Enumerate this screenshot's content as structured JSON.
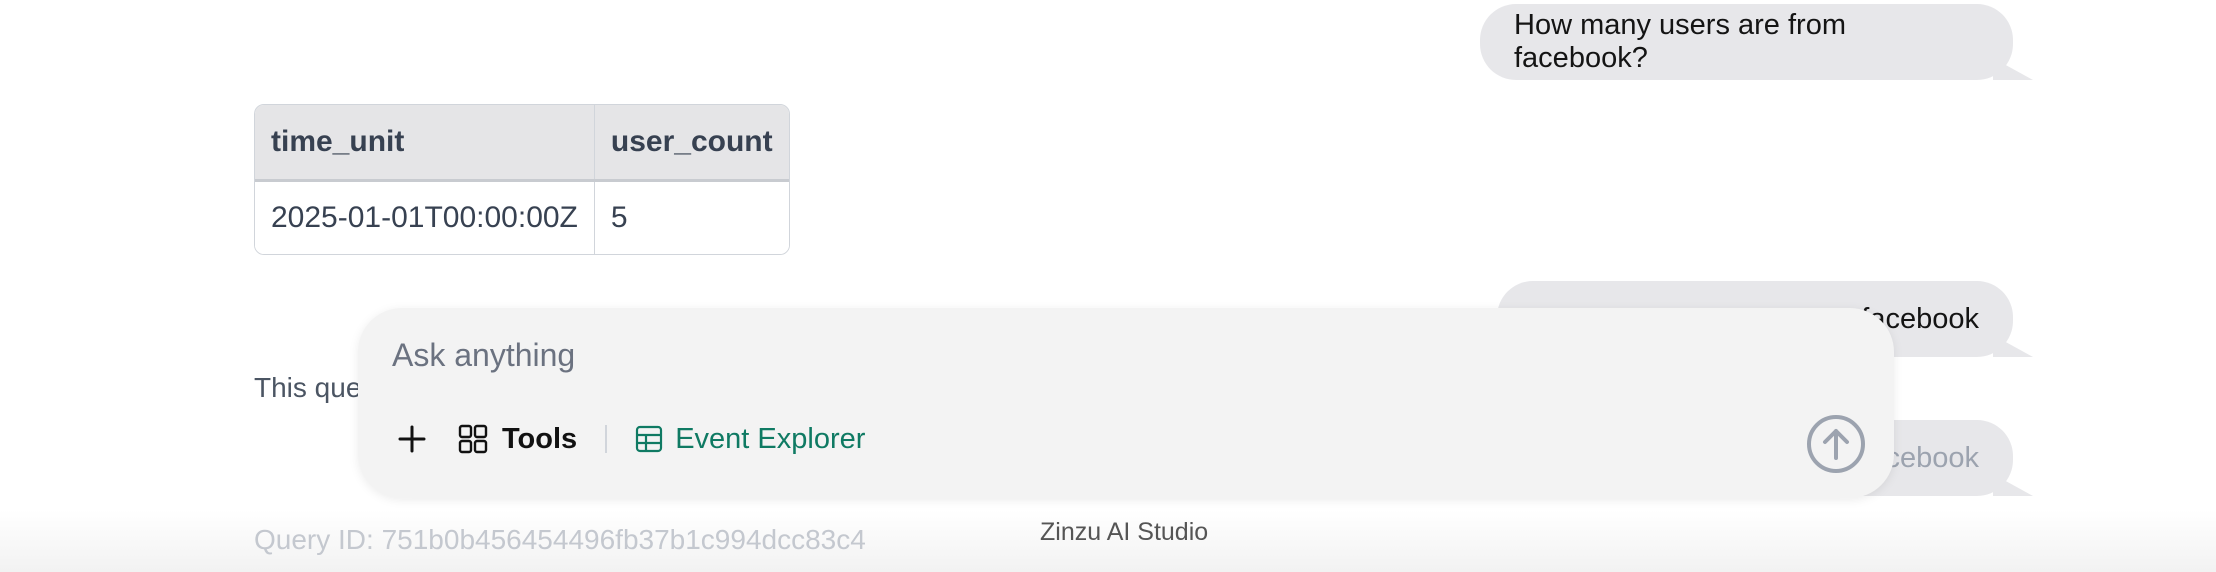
{
  "chat": {
    "messages": [
      "How many users are from facebook?",
      "facebook",
      "cebook"
    ]
  },
  "result": {
    "columns": [
      "time_unit",
      "user_count"
    ],
    "rows": [
      [
        "2025-01-01T00:00:00Z",
        "5"
      ]
    ]
  },
  "partial_text": "This que",
  "query_id": "Query ID: 751b0b456454496fb37b1c994dcc83c4",
  "composer": {
    "placeholder": "Ask anything",
    "tools_label": "Tools",
    "event_explorer_label": "Event Explorer",
    "accent_color": "#0f7a63"
  },
  "footer": {
    "brand": "Zinzu AI Studio"
  }
}
